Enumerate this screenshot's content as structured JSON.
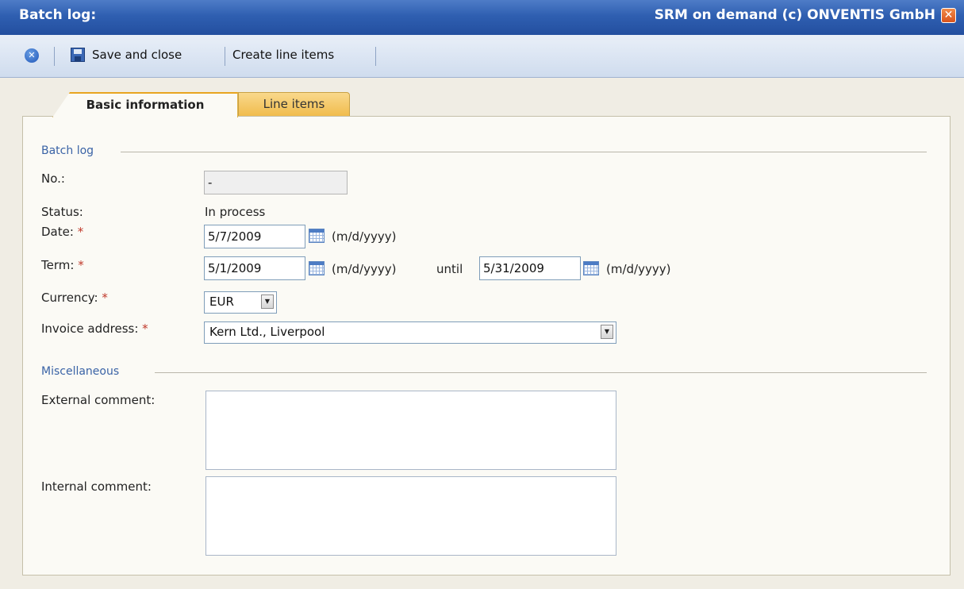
{
  "window": {
    "title": "Batch log:",
    "brand": "SRM on demand (c) ONVENTIS GmbH",
    "close_glyph": "✕"
  },
  "toolbar": {
    "cancel_icon": "cancel-circle-icon",
    "save_close_label": "Save and close",
    "create_items_label": "Create line items"
  },
  "tabs": [
    {
      "label": "Basic information",
      "active": true
    },
    {
      "label": "Line items",
      "active": false
    }
  ],
  "sections": {
    "batch_log": "Batch log",
    "misc": "Miscellaneous"
  },
  "form": {
    "no_label": "No.:",
    "no_value": "-",
    "status_label": "Status:",
    "status_value": "In process",
    "date_label": "Date:",
    "date_value": "5/7/2009",
    "date_format": "(m/d/yyyy)",
    "term_label": "Term:",
    "term_from": "5/1/2009",
    "term_until_label": "until",
    "term_to": "5/31/2009",
    "currency_label": "Currency:",
    "currency_value": "EUR",
    "invoice_label": "Invoice address:",
    "invoice_value": "Kern Ltd., Liverpool",
    "required_mark": "*",
    "ext_comment_label": "External comment:",
    "int_comment_label": "Internal comment:"
  },
  "colors": {
    "title_bar": "#2f5fb1",
    "tab_active_accent": "#e8a520",
    "tab_inactive": "#f0bb4a",
    "legend": "#3a63a6",
    "required": "#c0392b"
  }
}
